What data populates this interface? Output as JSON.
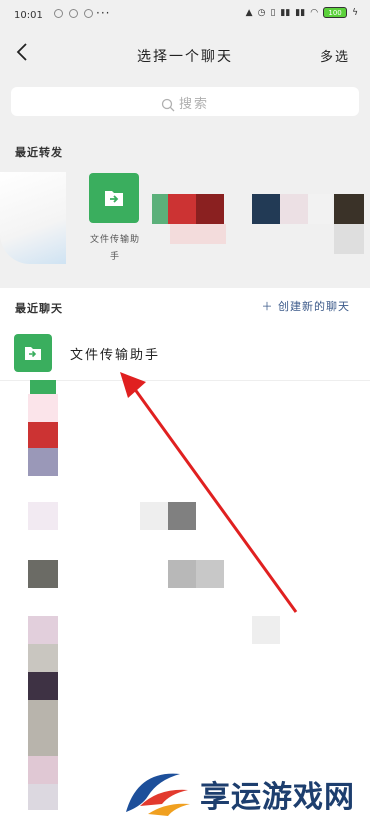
{
  "status_bar": {
    "time": "10:01",
    "battery": "100"
  },
  "nav": {
    "back_icon": "chevron-left-icon",
    "title": "选择一个聊天",
    "multi_select": "多选"
  },
  "search": {
    "placeholder": "搜索",
    "icon": "search-icon"
  },
  "recent_forward": {
    "label": "最近转发",
    "file_transfer_label": "文件传输助手"
  },
  "recent_chats": {
    "label": "最近聊天",
    "new_chat": "＋ 创建新的聊天",
    "items": [
      {
        "name": "文件传输助手"
      }
    ]
  },
  "watermark": {
    "text": "享运游戏网"
  },
  "colors": {
    "file_green": "#3aae5e",
    "arrow_red": "#e02020",
    "link_blue": "#3c5a8a"
  }
}
